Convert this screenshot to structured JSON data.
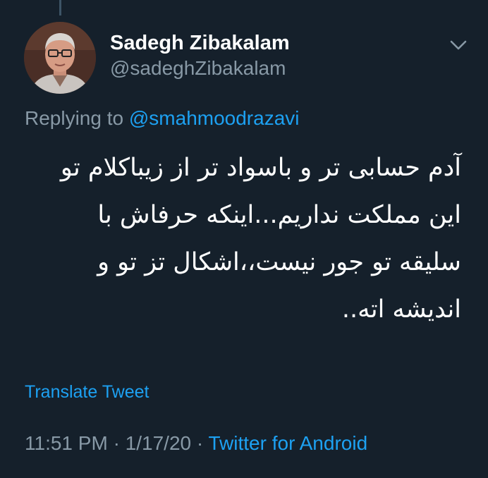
{
  "tweet": {
    "author": {
      "display_name": "Sadegh Zibakalam",
      "handle": "@sadeghZibakalam"
    },
    "menu_icon": "chevron-down-icon",
    "replying_prefix": "Replying to",
    "replying_to": "@smahmoodrazavi",
    "text_lines": [
      "آدم حسابی تر و باسواد تر از زیباکلام تو",
      "این مملکت نداریم...اینکه حرفاش با",
      "سلیقه تو جور نیست،،اشکال تز تو و",
      "اندیشه اته.."
    ],
    "translate_label": "Translate Tweet",
    "time": "11:51 PM",
    "date": "1/17/20",
    "separator": "·",
    "source": "Twitter for Android"
  },
  "colors": {
    "background": "#15202b",
    "primary_text": "#ffffff",
    "secondary_text": "#8899a6",
    "accent": "#1da1f2"
  }
}
